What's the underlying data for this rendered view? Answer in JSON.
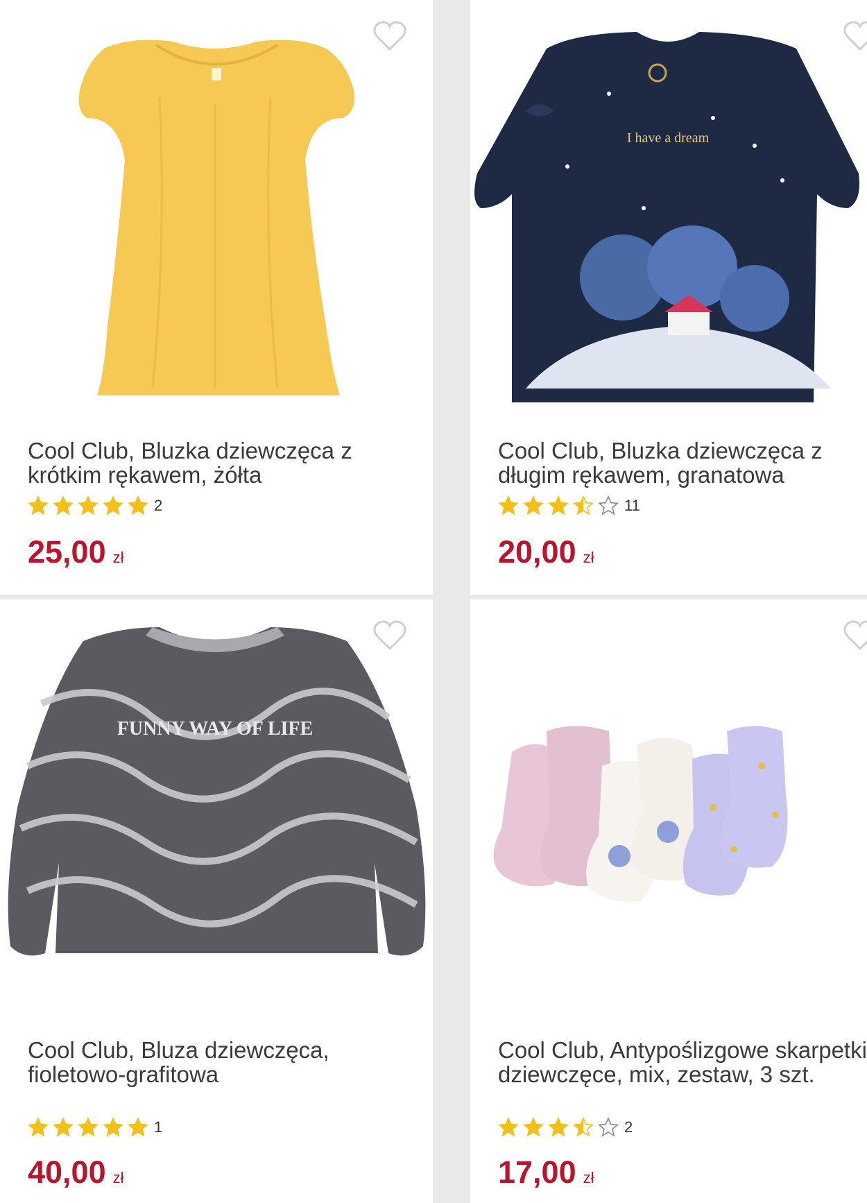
{
  "products": [
    {
      "title": "Cool Club, Bluzka dziewczęca z krótkim rękawem, żółta",
      "rating": 5,
      "review_count": "2",
      "price": "25,00",
      "currency": "zł",
      "image": "yellow-blouse-image"
    },
    {
      "title": "Cool Club, Bluzka dziewczęca z długim rękawem, granatowa",
      "rating": 3.5,
      "review_count": "11",
      "price": "20,00",
      "currency": "zł",
      "image": "navy-longsleeve-image",
      "print_text": "I have a dream"
    },
    {
      "title": "Cool Club, Bluza dziewczęca, fioletowo-grafitowa",
      "rating": 5,
      "review_count": "1",
      "price": "40,00",
      "currency": "zł",
      "image": "sweatshirt-image",
      "print_text": "FUNNY WAY OF LIFE"
    },
    {
      "title": "Cool Club, Antypoślizgowe skarpetki dziewczęce, mix, zestaw, 3 szt.",
      "rating": 3.5,
      "review_count": "2",
      "price": "17,00",
      "currency": "zł",
      "image": "socks-image"
    }
  ],
  "colors": {
    "price": "#b8162c",
    "star": "#f5bf1a",
    "star_empty": "#8a8a8a"
  }
}
